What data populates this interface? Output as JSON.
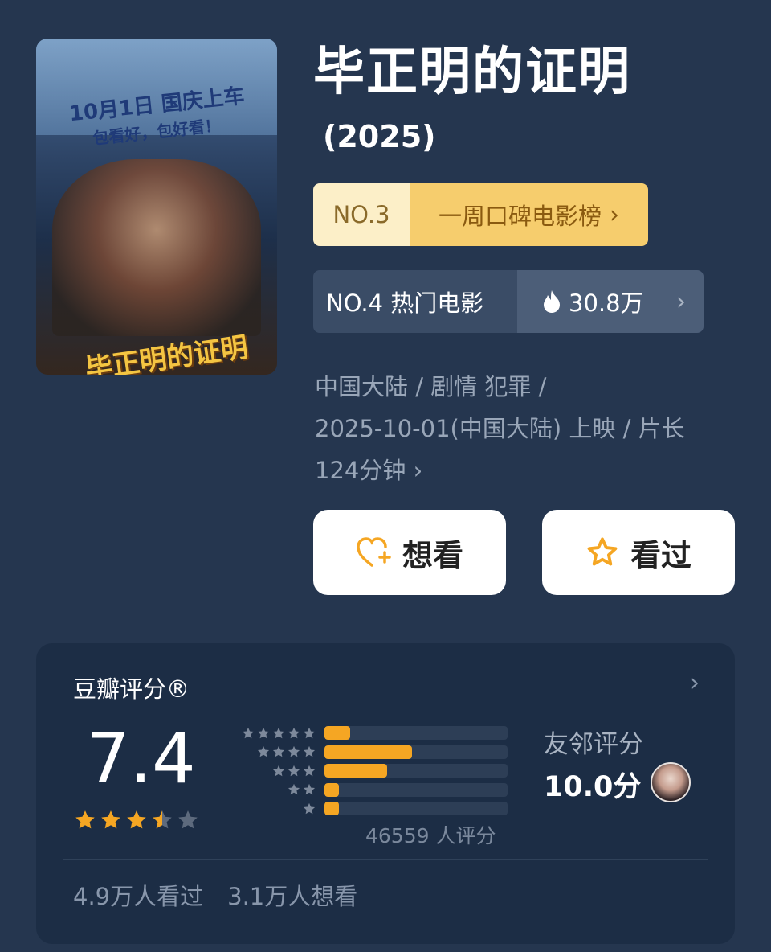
{
  "movie": {
    "title": "毕正明的证明",
    "year": "(2025)",
    "poster": {
      "tagline_1": "10月1日 国庆上车",
      "tagline_2": "包看好，包好看！",
      "title": "毕正明的证明"
    }
  },
  "ranks": {
    "top": {
      "no": "NO.3",
      "name": "一周口碑电影榜"
    },
    "hot": {
      "label": "NO.4 热门电影",
      "heat": "30.8万"
    }
  },
  "meta": {
    "line1": "中国大陆 / 剧情 犯罪 /",
    "line2": "2025-10-01(中国大陆) 上映 / 片长",
    "line3": "124分钟"
  },
  "actions": {
    "want_label": "想看",
    "seen_label": "看过"
  },
  "rating": {
    "caption": "豆瓣评分®",
    "score": "7.4",
    "stars_value": 3.5,
    "stars_max": 5,
    "distribution": [
      {
        "stars": 5,
        "fraction": 0.14
      },
      {
        "stars": 4,
        "fraction": 0.48
      },
      {
        "stars": 3,
        "fraction": 0.34
      },
      {
        "stars": 2,
        "fraction": 0.08
      },
      {
        "stars": 1,
        "fraction": 0.08
      }
    ],
    "count": "46559 人评分",
    "friend_label": "友邻评分",
    "friend_score": "10.0分"
  },
  "stats": {
    "seen": "4.9万人看过",
    "want": "3.1万人想看"
  },
  "colors": {
    "background": "#25364f",
    "accent": "#f5a623",
    "card": "#1c2d45"
  }
}
